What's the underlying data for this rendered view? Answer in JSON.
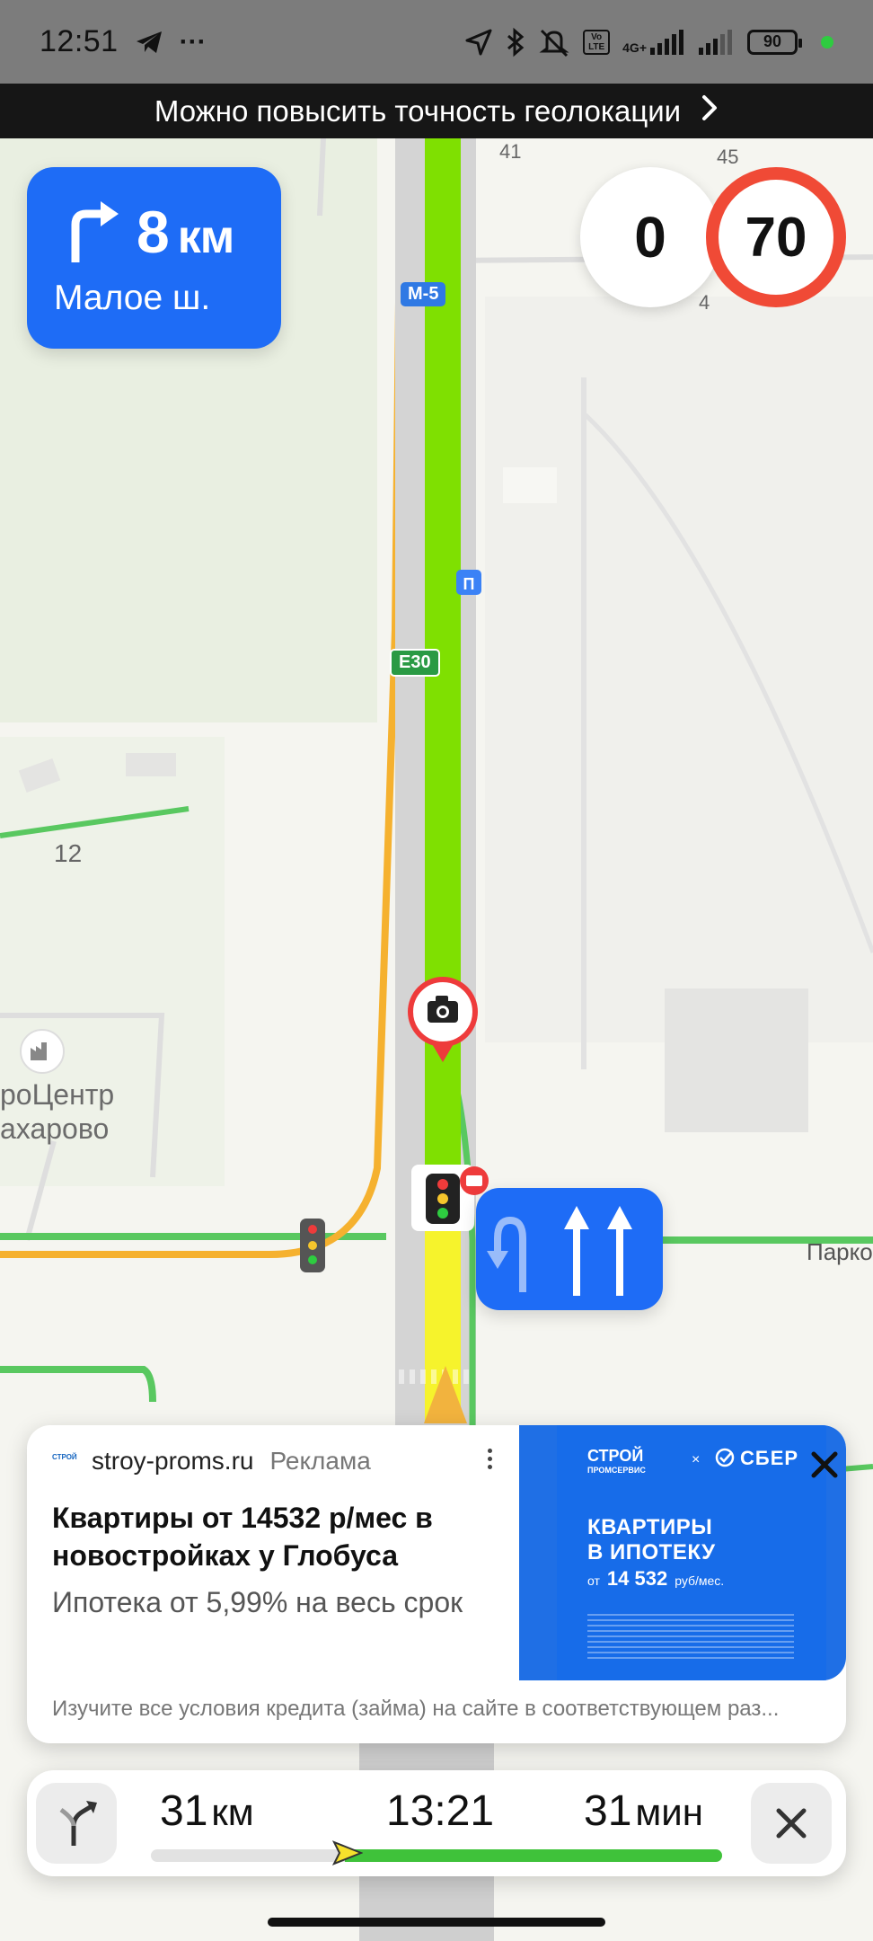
{
  "status_bar": {
    "time": "12:51",
    "more": "···",
    "network": "4G+",
    "volte": "Vo LTE",
    "battery": "90",
    "icons": [
      "telegram-icon",
      "location-icon",
      "bluetooth-icon",
      "mute-icon",
      "signal-icon",
      "battery-icon"
    ]
  },
  "banner": {
    "text": "Можно повысить точность геолокации",
    "chevron": "›"
  },
  "maneuver": {
    "distance": "8",
    "unit": "км",
    "street": "Малое ш.",
    "icon": "turn-right-icon"
  },
  "speed": {
    "current": "0",
    "limit": "70"
  },
  "map": {
    "road_shields": [
      "M-5",
      "E30"
    ],
    "house_numbers": [
      "41",
      "45",
      "4",
      "12"
    ],
    "poi_name_line1": "роЦентр",
    "poi_name_line2": "ахарово",
    "street_label": "Парко",
    "colors": {
      "route": "#7fe001",
      "route_slow": "#f6f32c",
      "road_green": "#59c860",
      "road_orange": "#f5b12f",
      "camera": "#ee3b3b"
    }
  },
  "lanes": {
    "lanes": [
      "u-turn-left",
      "straight",
      "straight"
    ]
  },
  "ad": {
    "logo": "СТРОЙ",
    "domain": "stroy-proms.ru",
    "tag": "Реклама",
    "title": "Квартиры от 14532 р/мес в новостройках у Глобуса",
    "subtitle": "Ипотека от 5,99% на весь срок",
    "image_brand_line1": "СТРОЙ",
    "image_brand_line2": "ПРОМСЕРВИС",
    "image_x": "×",
    "image_partner": "СБЕР",
    "image_headline_line1": "КВАРТИРЫ",
    "image_headline_line2": "В ИПОТЕКУ",
    "image_price_prefix": "от",
    "image_price": "14 532",
    "image_price_unit": "руб/мес.",
    "footer": "Изучите все условия кредита (займа) на сайте в соответствующем раз..."
  },
  "route_bar": {
    "distance": "31",
    "distance_unit": "км",
    "arrival": "13:21",
    "duration": "31",
    "duration_unit": "мин",
    "progress": 0.34
  }
}
